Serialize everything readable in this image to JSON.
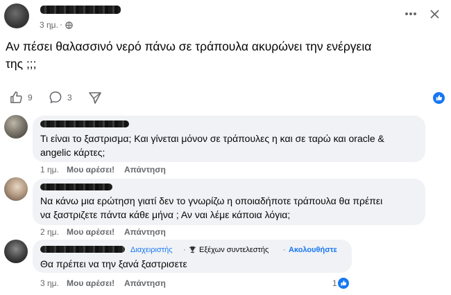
{
  "post": {
    "timestamp": "3 ημ.",
    "audience_icon": "globe-icon",
    "more_icon": "more-dots-icon",
    "close_icon": "close-icon",
    "text_line1": "Αν πέσει θαλασσινό νερό πάνω σε τράπουλα ακυρώνει την ενέργεια",
    "text_line2": "της ;;;",
    "like_count": "9",
    "comment_count": "3"
  },
  "comments": [
    {
      "line1": "Τι είναι το ξαστρισμα; Και γίνεται μόνον σε τράπουλες η και σε ταρώ και oracle &",
      "line2": "angelic κάρτες;",
      "time": "1 ημ.",
      "like_label": "Μου αρέσει!",
      "reply_label": "Απάντηση"
    },
    {
      "line1": "Να κάνω μια ερώτηση γιατί δεν το γνωρίζω η οποιαδήποτε τράπουλα θα πρέπει",
      "line2": "να ξαστριζετε πάντα κάθε μήνα ; Αν ναι λέμε κάποια λόγια;",
      "time": "2 ημ.",
      "like_label": "Μου αρέσει!",
      "reply_label": "Απάντηση"
    },
    {
      "badge_admin": "Διαχειριστής",
      "badge_contributor": "Εξέχων συντελεστής",
      "follow_label": "Ακολουθήστε",
      "line1": "Θα πρέπει να την ξανά ξαστρισετε",
      "time": "3 ημ.",
      "like_label": "Μου αρέσει!",
      "reply_label": "Απάντηση",
      "reaction_count": "1"
    }
  ],
  "colors": {
    "accent": "#1877f2",
    "bubble": "#f0f2f5",
    "meta": "#65676b"
  }
}
